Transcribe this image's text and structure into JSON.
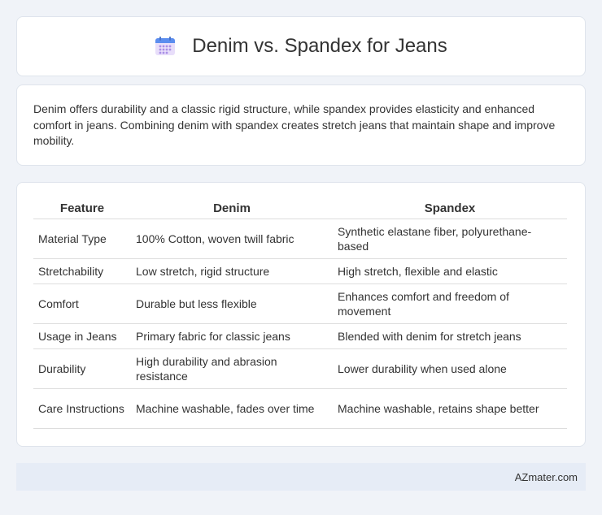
{
  "header": {
    "title": "Denim vs. Spandex for Jeans",
    "icon": "calendar-icon",
    "icon_colors": {
      "top": "#5b8def",
      "body": "#e8defa",
      "dots": "#a98ee6"
    }
  },
  "intro": {
    "text": "Denim offers durability and a classic rigid structure, while spandex provides elasticity and enhanced comfort in jeans. Combining denim with spandex creates stretch jeans that maintain shape and improve mobility."
  },
  "table": {
    "headers": [
      "Feature",
      "Denim",
      "Spandex"
    ],
    "rows": [
      [
        "Material Type",
        "100% Cotton, woven twill fabric",
        "Synthetic elastane fiber, polyurethane-based"
      ],
      [
        "Stretchability",
        "Low stretch, rigid structure",
        "High stretch, flexible and elastic"
      ],
      [
        "Comfort",
        "Durable but less flexible",
        "Enhances comfort and freedom of movement"
      ],
      [
        "Usage in Jeans",
        "Primary fabric for classic jeans",
        "Blended with denim for stretch jeans"
      ],
      [
        "Durability",
        "High durability and abrasion resistance",
        "Lower durability when used alone"
      ],
      [
        "Care Instructions",
        "Machine washable, fades over time",
        "Machine washable, retains shape better"
      ]
    ]
  },
  "footer": {
    "brand": "AZmater.com"
  }
}
